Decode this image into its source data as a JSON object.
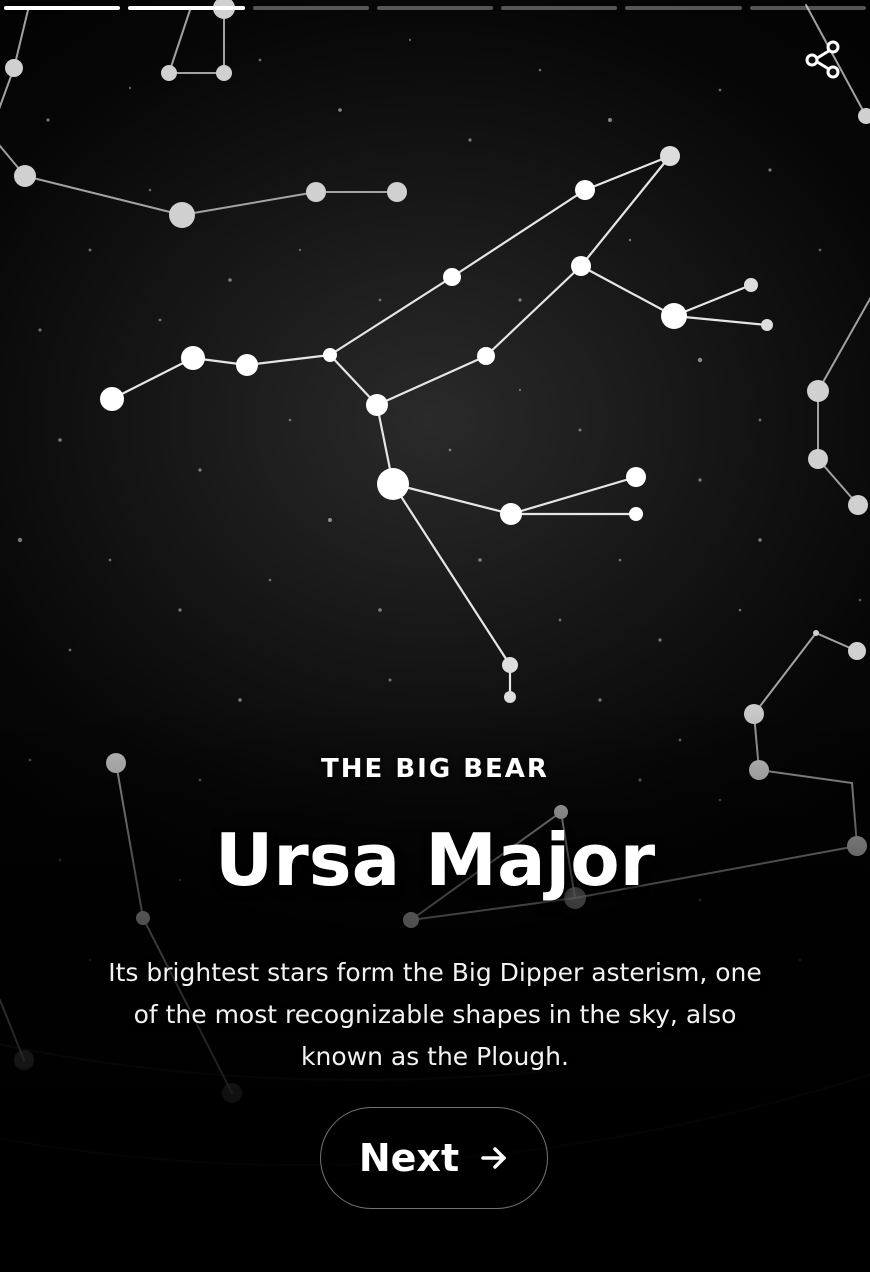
{
  "story": {
    "progress_total": 7,
    "progress_completed": 2
  },
  "header": {
    "share_icon": "share-icon"
  },
  "slide": {
    "eyebrow": "THE BIG BEAR",
    "title": "Ursa Major",
    "description": "Its brightest stars form the Big Dipper asterism, one of the most recognizable shapes in the sky, also known as the Plough."
  },
  "actions": {
    "next_label": "Next",
    "next_icon": "arrow-right-icon"
  },
  "colors": {
    "text": "#ffffff",
    "background": "#0a0a0a",
    "progress_active": "#ffffff",
    "progress_inactive": "#6b6b6b"
  }
}
